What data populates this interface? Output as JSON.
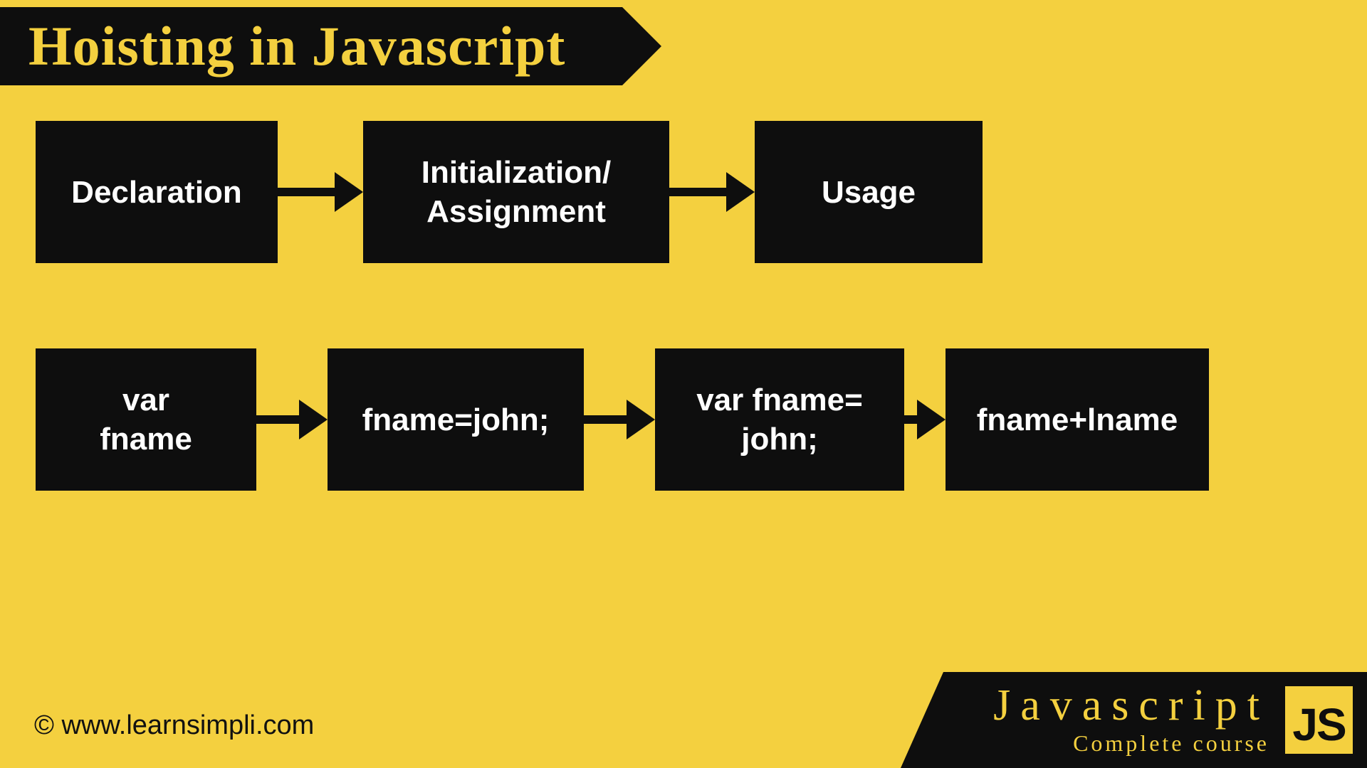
{
  "title": "Hoisting in Javascript",
  "row1": {
    "declaration": "Declaration",
    "init_line1": "Initialization/",
    "init_line2": "Assignment",
    "usage": "Usage"
  },
  "row2": {
    "var_line1": "var",
    "var_line2": "fname",
    "assign": "fname=john;",
    "decl_assign_line1": "var fname=",
    "decl_assign_line2": "john;",
    "usage_expr": "fname+lname"
  },
  "footer": {
    "copyright": "© www.learnsimpli.com"
  },
  "badge": {
    "title": "Javascript",
    "subtitle": "Complete course",
    "logo": "JS"
  }
}
